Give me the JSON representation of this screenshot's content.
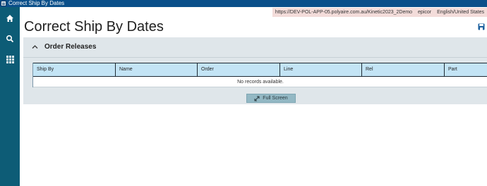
{
  "window": {
    "title": "Correct Ship By Dates",
    "icon": "app-window-icon"
  },
  "sidebar": {
    "items": [
      {
        "icon": "home-icon"
      },
      {
        "icon": "search-icon"
      },
      {
        "icon": "apps-grid-icon"
      }
    ]
  },
  "context": {
    "server_url": "https://DEV-POL-APP-05.polyaire.com.au/Kinetic2023_2Demo",
    "user": "epicor",
    "language": "English/United States"
  },
  "page": {
    "title": "Correct Ship By Dates"
  },
  "panel": {
    "title": "Order Releases"
  },
  "grid": {
    "columns": [
      "Ship By",
      "Name",
      "Order",
      "Line",
      "Rel",
      "Part"
    ],
    "empty_message": "No records available."
  },
  "actions": {
    "full_screen_label": "Full Screen"
  },
  "colors": {
    "titlebar": "#0a4f8a",
    "sidebar": "#0d5c76",
    "panel": "#dfe6ea",
    "grid_header": "#c3e4f5",
    "context_bg": "#f3dcda",
    "button": "#93b8c4"
  }
}
